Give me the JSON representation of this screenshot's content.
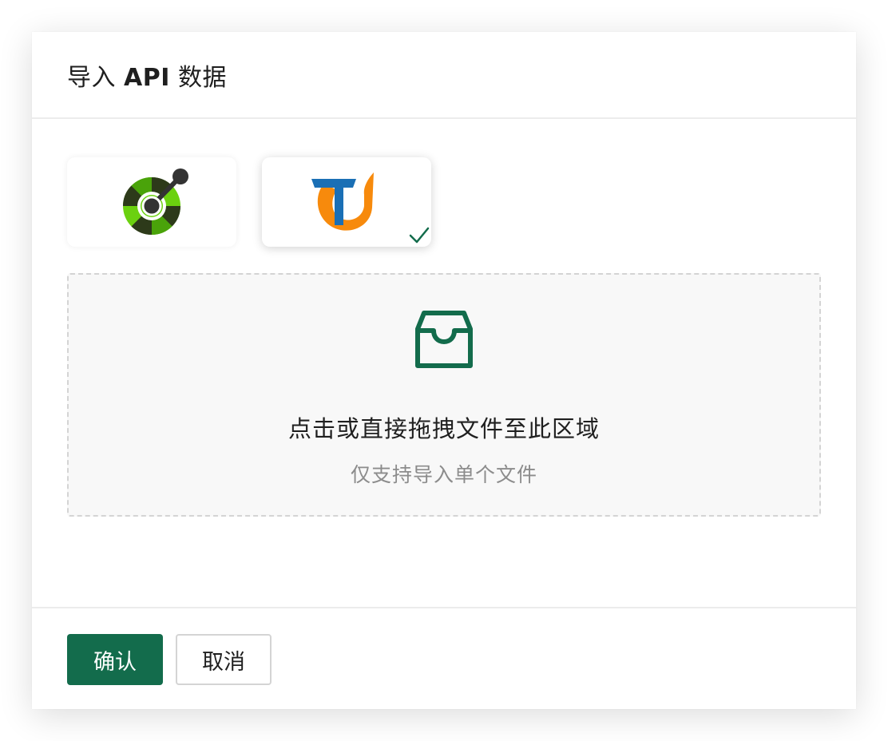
{
  "modal": {
    "title_prefix": "导入",
    "title_api": "API",
    "title_suffix": "数据"
  },
  "sources": [
    {
      "name": "OpenAPI",
      "icon": "openapi-logo-icon",
      "selected": false
    },
    {
      "name": "Torna",
      "icon": "torna-logo-icon",
      "selected": true
    }
  ],
  "dropzone": {
    "icon": "inbox-icon",
    "primary_text": "点击或直接拖拽文件至此区域",
    "hint_text": "仅支持导入单个文件"
  },
  "footer": {
    "confirm_label": "确认",
    "cancel_label": "取消"
  },
  "colors": {
    "primary": "#136c4c",
    "torna_blue": "#1a6fb5",
    "torna_orange": "#f78a0c",
    "openapi_green": "#6bd10f",
    "openapi_dark": "#2d3a1a"
  }
}
